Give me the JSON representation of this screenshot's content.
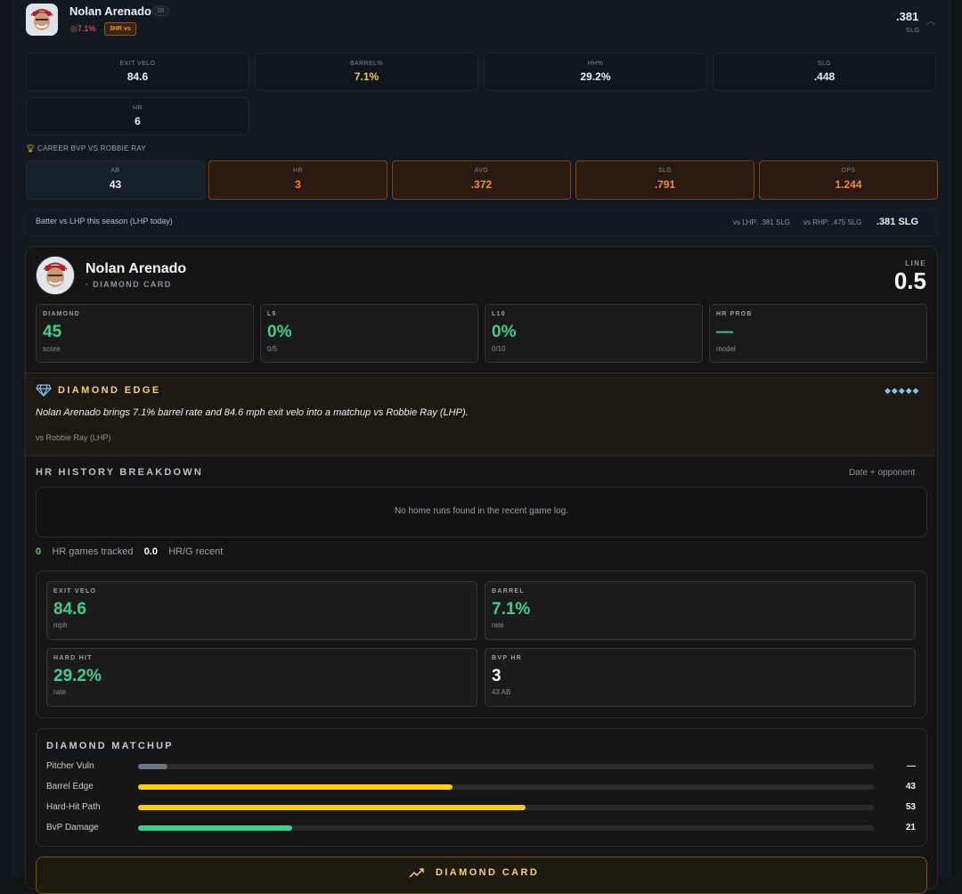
{
  "header": {
    "player_name": "Nolan Arenado",
    "position": "3B",
    "barrel_pct_badge": "7.1%",
    "hr_vs_badge": "3HR vs",
    "slg_value": ".381",
    "slg_label": "SLG"
  },
  "metrics": [
    {
      "label": "EXIT VELO",
      "value": "84.6",
      "tone": "white"
    },
    {
      "label": "BARREL%",
      "value": "7.1%",
      "tone": "gold"
    },
    {
      "label": "HH%",
      "value": "29.2%",
      "tone": "white"
    },
    {
      "label": "SLG",
      "value": ".448",
      "tone": "white"
    },
    {
      "label": "HR",
      "value": "6",
      "tone": "white"
    }
  ],
  "bvp": {
    "title": "CAREER BVP VS ROBBIE RAY",
    "stats": [
      {
        "label": "AB",
        "value": "43"
      },
      {
        "label": "HR",
        "value": "3"
      },
      {
        "label": "AVG",
        "value": ".372"
      },
      {
        "label": "SLG",
        "value": ".791"
      },
      {
        "label": "OPS",
        "value": "1.244"
      }
    ]
  },
  "lhp_row": {
    "text": "Batter vs LHP this season (LHP today)",
    "vs_lhp": "vs LHP: .381 SLG",
    "vs_rhp": "vs RHP: .475 SLG",
    "summary": ".381 SLG"
  },
  "card": {
    "player_name": "Nolan Arenado",
    "subtitle": "· DIAMOND CARD",
    "line_label": "LINE",
    "line_value": "0.5",
    "stats": [
      {
        "label": "DIAMOND",
        "value": "45",
        "sub": "score"
      },
      {
        "label": "L5",
        "value": "0%",
        "sub": "0/5"
      },
      {
        "label": "L10",
        "value": "0%",
        "sub": "0/10"
      },
      {
        "label": "HR PROB",
        "value": "—",
        "sub": "model"
      }
    ],
    "edge": {
      "title": "DIAMOND EDGE",
      "gems": "◆◆◆◆◆",
      "text": "Nolan Arenado brings 7.1% barrel rate and 84.6 mph exit velo into a matchup vs Robbie Ray (LHP).",
      "sub": "vs Robbie Ray (LHP)"
    },
    "history": {
      "title": "HR HISTORY BREAKDOWN",
      "right": "Date + opponent",
      "empty": "No home runs found in the recent game log.",
      "games_count": "0",
      "games_label": "HR games tracked",
      "rate_value": "0.0",
      "rate_label": "HR/G recent"
    },
    "cells": [
      {
        "label": "EXIT VELO",
        "value": "84.6",
        "sub": "mph"
      },
      {
        "label": "BARREL",
        "value": "7.1%",
        "sub": "rate"
      },
      {
        "label": "HARD HIT",
        "value": "29.2%",
        "sub": "rate"
      },
      {
        "label": "BVP HR",
        "value": "3",
        "sub": "43 AB"
      }
    ],
    "matchup": {
      "title": "DIAMOND MATCHUP",
      "bars": [
        {
          "label": "Pitcher Vuln",
          "value_text": "—",
          "fill": 0.04,
          "color": "#6b7280"
        },
        {
          "label": "Barrel Edge",
          "value_text": "43",
          "fill": 0.427,
          "color": "#facc15"
        },
        {
          "label": "Hard-Hit Path",
          "value_text": "53",
          "fill": 0.527,
          "color": "#facc15"
        },
        {
          "label": "BvP Damage",
          "value_text": "21",
          "fill": 0.21,
          "color": "#3ecf8e"
        }
      ]
    },
    "button_label": "DIAMOND CARD"
  }
}
